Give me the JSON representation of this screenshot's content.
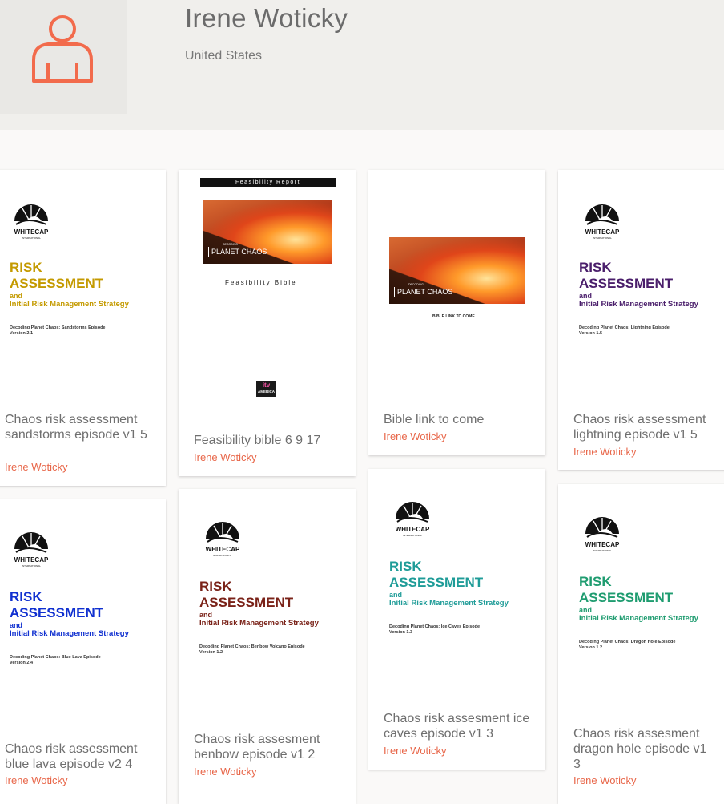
{
  "profile": {
    "name": "Irene Woticky",
    "location": "United States"
  },
  "colors": {
    "author": "#e8674a",
    "avatar_icon": "#f26b4c"
  },
  "documents": [
    {
      "title": "Chaos risk assessment sandstorms episode v1 5",
      "author": "Irene Woticky",
      "thumb": {
        "type": "risk",
        "logo": "WHITECAP",
        "logo_sub": "INTERNATIONAL",
        "heading1": "RISK",
        "heading2": "ASSESSMENT",
        "and": "and",
        "subheading": "Initial Risk Management Strategy",
        "episode": "Decoding Planet Chaos: Sandstorms Episode",
        "version": "Version 2.1",
        "color": "#c49a00"
      }
    },
    {
      "title": "Feasibility bible 6 9 17",
      "author": "Irene Woticky",
      "thumb": {
        "type": "feasibility",
        "bar_text": "Feasibility Report",
        "hero_small": "DECODING",
        "hero_title": "PLANET CHAOS",
        "doc_title": "Feasibility Bible",
        "badge_top": "itv",
        "badge_bottom": "AMERICA"
      }
    },
    {
      "title": "Bible link to come",
      "author": "Irene Woticky",
      "thumb": {
        "type": "bible",
        "hero_small": "DECODING",
        "hero_title": "PLANET CHAOS",
        "caption": "BIBLE LINK TO COME"
      }
    },
    {
      "title": "Chaos risk assessment lightning episode v1 5",
      "author": "Irene Woticky",
      "thumb": {
        "type": "risk",
        "logo": "WHITECAP",
        "logo_sub": "INTERNATIONAL",
        "heading1": "RISK",
        "heading2": "ASSESSMENT",
        "and": "and",
        "subheading": "Initial Risk Management Strategy",
        "episode": "Decoding Planet Chaos: Lightning Episode",
        "version": "Version 1.5",
        "color": "#4a1e6b"
      }
    },
    {
      "title": "Chaos risk assessment blue lava episode v2 4",
      "author": "Irene Woticky",
      "thumb": {
        "type": "risk",
        "logo": "WHITECAP",
        "logo_sub": "INTERNATIONAL",
        "heading1": "RISK",
        "heading2": "ASSESSMENT",
        "and": "and",
        "subheading": "Initial Risk Management Strategy",
        "episode": "Decoding Planet Chaos: Blue Lava Episode",
        "version": "Version 2.4",
        "color": "#1030d0"
      }
    },
    {
      "title": "Chaos risk assesment benbow episode v1 2",
      "author": "Irene Woticky",
      "thumb": {
        "type": "risk",
        "logo": "WHITECAP",
        "logo_sub": "INTERNATIONAL",
        "heading1": "RISK",
        "heading2": "ASSESSMENT",
        "and": "and",
        "subheading": "Initial Risk Management Strategy",
        "episode": "Decoding Planet Chaos: Benbow Volcano Episode",
        "version": "Version 1.2",
        "color": "#7a2218"
      }
    },
    {
      "title": "Chaos risk assesment ice caves episode v1 3",
      "author": "Irene Woticky",
      "thumb": {
        "type": "risk",
        "logo": "WHITECAP",
        "logo_sub": "INTERNATIONAL",
        "heading1": "RISK",
        "heading2": "ASSESSMENT",
        "and": "and",
        "subheading": "Initial Risk Management Strategy",
        "episode": "Decoding Planet Chaos: Ice Caves Episode",
        "version": "Version 1.3",
        "color": "#1f9c98"
      }
    },
    {
      "title": "Chaos risk assesment dragon hole episode v1 3",
      "author": "Irene Woticky",
      "thumb": {
        "type": "risk",
        "logo": "WHITECAP",
        "logo_sub": "INTERNATIONAL",
        "heading1": "RISK",
        "heading2": "ASSESSMENT",
        "and": "and",
        "subheading": "Initial Risk Management Strategy",
        "episode": "Decoding Planet Chaos: Dragon Hole Episode",
        "version": "Version 1.2",
        "color": "#1f9c70"
      }
    }
  ]
}
